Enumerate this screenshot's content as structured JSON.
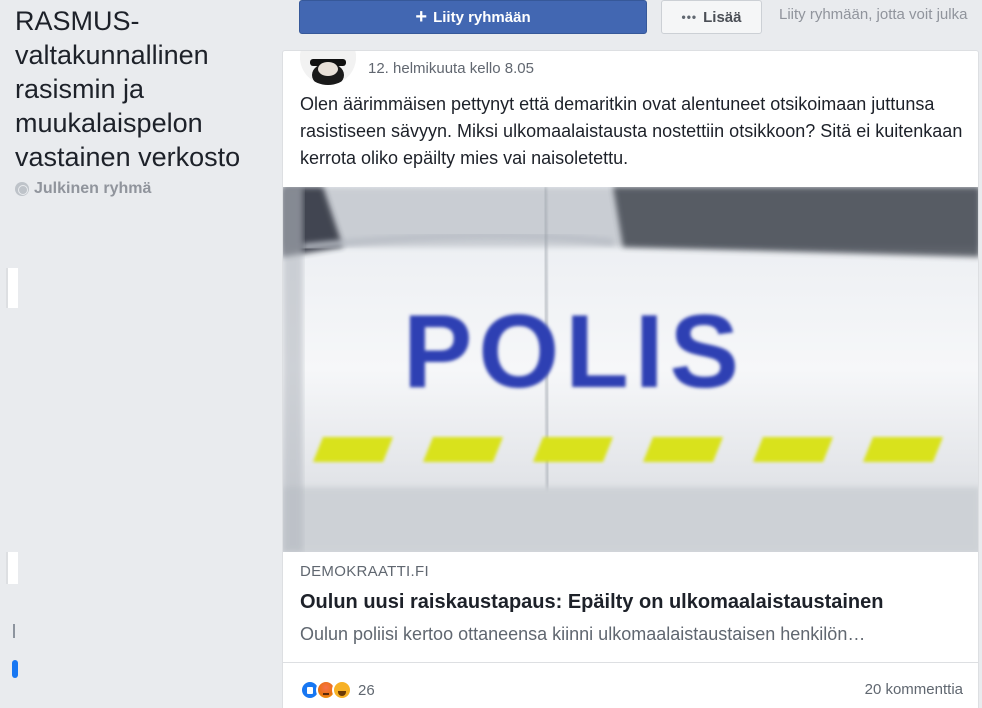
{
  "group": {
    "title": "RASMUS-valtakunnallinen rasismin ja muukalaispelon vastainen verkosto",
    "type_label": "Julkinen ryhmä",
    "type_icon": "globe-icon"
  },
  "actions": {
    "join_label": "Liity ryhmään",
    "join_icon": "plus-icon",
    "more_label": "Lisää",
    "more_icon": "dots-icon",
    "join_hint": "Liity ryhmään, jotta voit julka"
  },
  "post": {
    "timestamp": "12. helmikuuta kello 8.05",
    "text": "Olen äärimmäisen pettynyt että demaritkin ovat alentuneet otsikoimaan juttunsa rasistiseen sävyyn. Miksi ulkomaalaistausta nostettiin otsikkoon? Sitä ei kuitenkaan kerrota oliko epäilty mies vai naisoletettu.",
    "image": {
      "subject": "police-car-photo",
      "visible_text": "POLIS",
      "colors": {
        "blue": "#2d3fb3",
        "yellow": "#d9e21a",
        "body": "#f3f4f6"
      }
    },
    "link": {
      "domain": "DEMOKRAATTI.FI",
      "title": "Oulun uusi raiskaustapaus: Epäilty on ulkomaalaistaustainen",
      "description": "Oulun poliisi kertoo ottaneensa kiinni ulkomaalaistaustaisen henkilön…"
    },
    "reactions": {
      "icons": [
        "like-icon",
        "angry-icon",
        "haha-icon"
      ],
      "count": "26"
    },
    "comments_label": "20 kommenttia"
  },
  "colors": {
    "brand_blue": "#4267b2",
    "page_bg": "#e9ebee",
    "secondary_text": "#606770"
  }
}
